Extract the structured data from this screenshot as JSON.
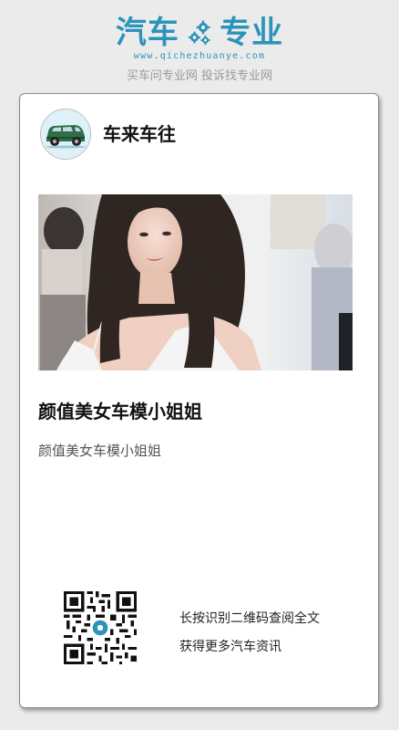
{
  "header": {
    "logo_left": "汽车",
    "logo_right": "专业",
    "domain": "www.qichezhuanye.com",
    "tagline": "买车问专业网 投诉找专业网"
  },
  "card": {
    "channel_name": "车来车往",
    "title": "颜值美女车模小姐姐",
    "summary": "颜值美女车模小姐姐",
    "cta_line1": "长按识别二维码查阅全文",
    "cta_line2": "获得更多汽车资讯"
  },
  "colors": {
    "brand": "#2c93b9",
    "background": "#ebebeb",
    "card": "#ffffff"
  },
  "icons": {
    "logo_gear": "gears-icon",
    "avatar": "car-avatar-icon",
    "qr": "qr-code-icon"
  }
}
